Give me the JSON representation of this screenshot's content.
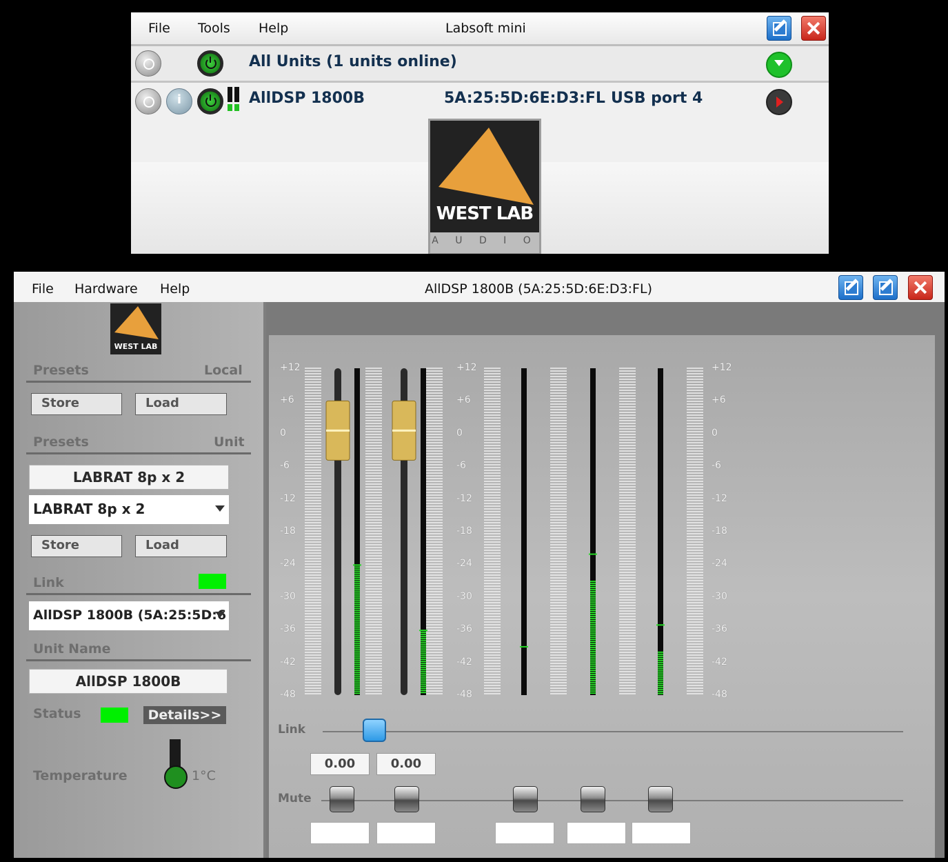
{
  "top_window": {
    "menu": [
      "File",
      "Tools",
      "Help"
    ],
    "title": "Labsoft mini",
    "all_units_label": "All Units (1 units online)",
    "unit": {
      "name": "AllDSP 1800B",
      "mac": "5A:25:5D:6E:D3:FL",
      "port": "USB port 4"
    },
    "logo": {
      "brand": "WEST LAB",
      "sub": "A U D I O",
      "color": "#e8a03c"
    }
  },
  "device_window": {
    "menu": [
      "File",
      "Hardware",
      "Help"
    ],
    "title": "AllDSP 1800B (5A:25:5D:6E:D3:FL)",
    "left_panel": {
      "presets_local": {
        "header": "Presets",
        "scope": "Local",
        "store": "Store",
        "load": "Load"
      },
      "presets_unit": {
        "header": "Presets",
        "scope": "Unit",
        "current_name": "LABRAT 8p x 2",
        "selected": "LABRAT 8p x 2",
        "store": "Store",
        "load": "Load"
      },
      "link": {
        "header": "Link",
        "selected": "AllDSP 1800B (5A:25:5D:6",
        "indicator_color": "#00f000"
      },
      "unit_name": {
        "header": "Unit Name",
        "value": "AllDSP 1800B"
      },
      "status": {
        "label": "Status",
        "details": "Details>>",
        "indicator_color": "#00f000"
      },
      "temperature": {
        "label": "Temperature",
        "value": "1°C"
      }
    },
    "mixer": {
      "scale": [
        "+12",
        "+6",
        "0",
        "-6",
        "-12",
        "-18",
        "-24",
        "-30",
        "-36",
        "-42",
        "-48"
      ],
      "link_label": "Link",
      "mute_label": "Mute",
      "gain_values": [
        "0.00",
        "0.00"
      ],
      "meters": [
        {
          "level_db": -24,
          "peak_db": -24
        },
        {
          "level_db": -36,
          "peak_db": -36
        },
        {
          "level_db": null,
          "peak_db": -39
        },
        {
          "level_db": -27,
          "peak_db": -22
        },
        {
          "level_db": -40,
          "peak_db": -35
        },
        {
          "level_db": null,
          "peak_db": null
        }
      ]
    }
  }
}
